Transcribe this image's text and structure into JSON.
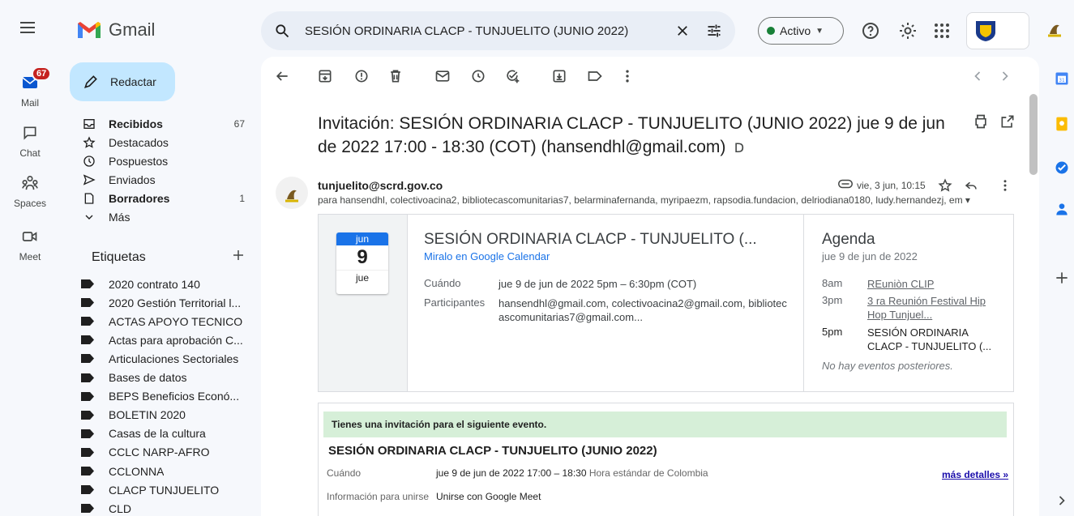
{
  "app": {
    "name": "Gmail"
  },
  "search": {
    "query": "SESIÓN ORDINARIA CLACP - TUNJUELITO (JUNIO 2022)"
  },
  "status": {
    "label": "Activo"
  },
  "rail": [
    {
      "label": "Mail",
      "badge": "67"
    },
    {
      "label": "Chat"
    },
    {
      "label": "Spaces"
    },
    {
      "label": "Meet"
    }
  ],
  "compose": {
    "label": "Redactar"
  },
  "nav": [
    {
      "label": "Recibidos",
      "count": "67",
      "bold": true
    },
    {
      "label": "Destacados",
      "count": ""
    },
    {
      "label": "Pospuestos",
      "count": ""
    },
    {
      "label": "Enviados",
      "count": ""
    },
    {
      "label": "Borradores",
      "count": "1",
      "bold": true
    },
    {
      "label": "Más",
      "count": ""
    }
  ],
  "labels": {
    "heading": "Etiquetas",
    "items": [
      "2020 contrato 140",
      "2020 Gestión Territorial l...",
      "ACTAS APOYO TECNICO",
      "Actas para aprobación C...",
      "Articulaciones Sectoriales",
      "Bases de datos",
      "BEPS Beneficios Econó...",
      "BOLETIN 2020",
      "Casas de la cultura",
      "CCLC NARP-AFRO",
      "CCLONNA",
      "CLACP TUNJUELITO",
      "CLD"
    ]
  },
  "message": {
    "subject": "Invitación: SESIÓN ORDINARIA CLACP - TUNJUELITO (JUNIO 2022) jue 9 de jun de 2022 17:00 - 18:30 (COT) (hansendhl@gmail.com)",
    "sender": "tunjuelito@scrd.gov.co",
    "recipients": "para hansendhl, colectivoacina2, bibliotecascomunitarias7, belarminafernanda, myripaezm, rapsodia.fundacion, delriodiana0180, ludy.hernandezj, em",
    "date": "vie, 3 jun, 10:15"
  },
  "event": {
    "month": "jun",
    "day": "9",
    "weekday": "jue",
    "title": "SESIÓN ORDINARIA CLACP - TUNJUELITO (...",
    "calendar_link": "Miralo en Google Calendar",
    "when_label": "Cuándo",
    "when_value": "jue 9 de jun de 2022 5pm – 6:30pm (COT)",
    "participants_label": "Participantes",
    "participants_value": "hansendhl@gmail.com, colectivoacina2@gmail.com, bibliotecascomunitarias7@gmail.com..."
  },
  "agenda": {
    "heading": "Agenda",
    "date": "jue 9 de jun de 2022",
    "items": [
      {
        "time": "8am",
        "title": "REuniòn CLIP"
      },
      {
        "time": "3pm",
        "title": "3 ra Reunión Festival Hip Hop Tunjuel..."
      },
      {
        "time": "5pm",
        "title": "SESIÓN ORDINARIA CLACP - TUNJUELITO (..."
      }
    ],
    "none": "No hay eventos posteriores."
  },
  "invitation": {
    "banner": "Tienes una invitación para el siguiente evento.",
    "title": "SESIÓN ORDINARIA CLACP - TUNJUELITO (JUNIO 2022)",
    "when_label": "Cuándo",
    "when_value": "jue 9 de jun de 2022 17:00 – 18:30",
    "when_tz": "Hora estándar de Colombia",
    "more": "más detalles »",
    "join_label": "Información para unirse",
    "join_value": "Unirse con Google Meet"
  },
  "colors": {
    "accent": "#1a73e8",
    "compose": "#c2e7ff",
    "badge": "#c5221f",
    "active": "#188038"
  }
}
